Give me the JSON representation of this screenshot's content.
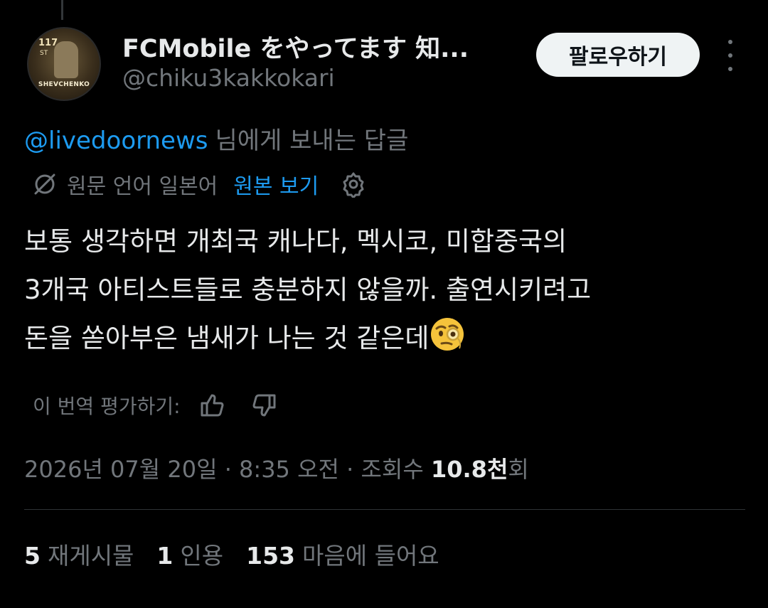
{
  "author": {
    "display_name": "FCMobile をやってます 知...",
    "handle": "@chiku3kakkokari",
    "avatar": {
      "rating": "117",
      "position": "ST",
      "player_name": "SHEVCHENKO"
    }
  },
  "follow_label": "팔로우하기",
  "reply_to": {
    "mention": "@livedoornews",
    "suffix": "님에게 보내는 답글"
  },
  "translation": {
    "original_language": "원문 언어 일본어",
    "show_original": "원본 보기",
    "rate_label": "이 번역 평가하기:"
  },
  "body": {
    "line1": "보통 생각하면 개최국 캐나다, 멕시코, 미합중국의",
    "line2": "3개국 아티스트들로 충분하지 않을까. 출연시키려고",
    "line3": "돈을 쏟아부은 냄새가 나는 것 같은데"
  },
  "meta": {
    "timestamp": "2026년 07월 20일 · 8:35 오전 · 조회수 ",
    "views": "10.8천",
    "views_suffix": "회"
  },
  "stats": {
    "reposts_count": "5",
    "reposts_label": "재게시물",
    "quotes_count": "1",
    "quotes_label": "인용",
    "likes_count": "153",
    "likes_label": "마음에 들어요"
  },
  "colors": {
    "accent": "#1d9bf0",
    "background": "#000000",
    "secondary_text": "#71767b",
    "primary_text": "#e7e9ea"
  },
  "icons": [
    "globe-slash-icon",
    "gear-icon",
    "thumbs-up-icon",
    "thumbs-down-icon",
    "more-icon",
    "monocle-face-emoji"
  ]
}
